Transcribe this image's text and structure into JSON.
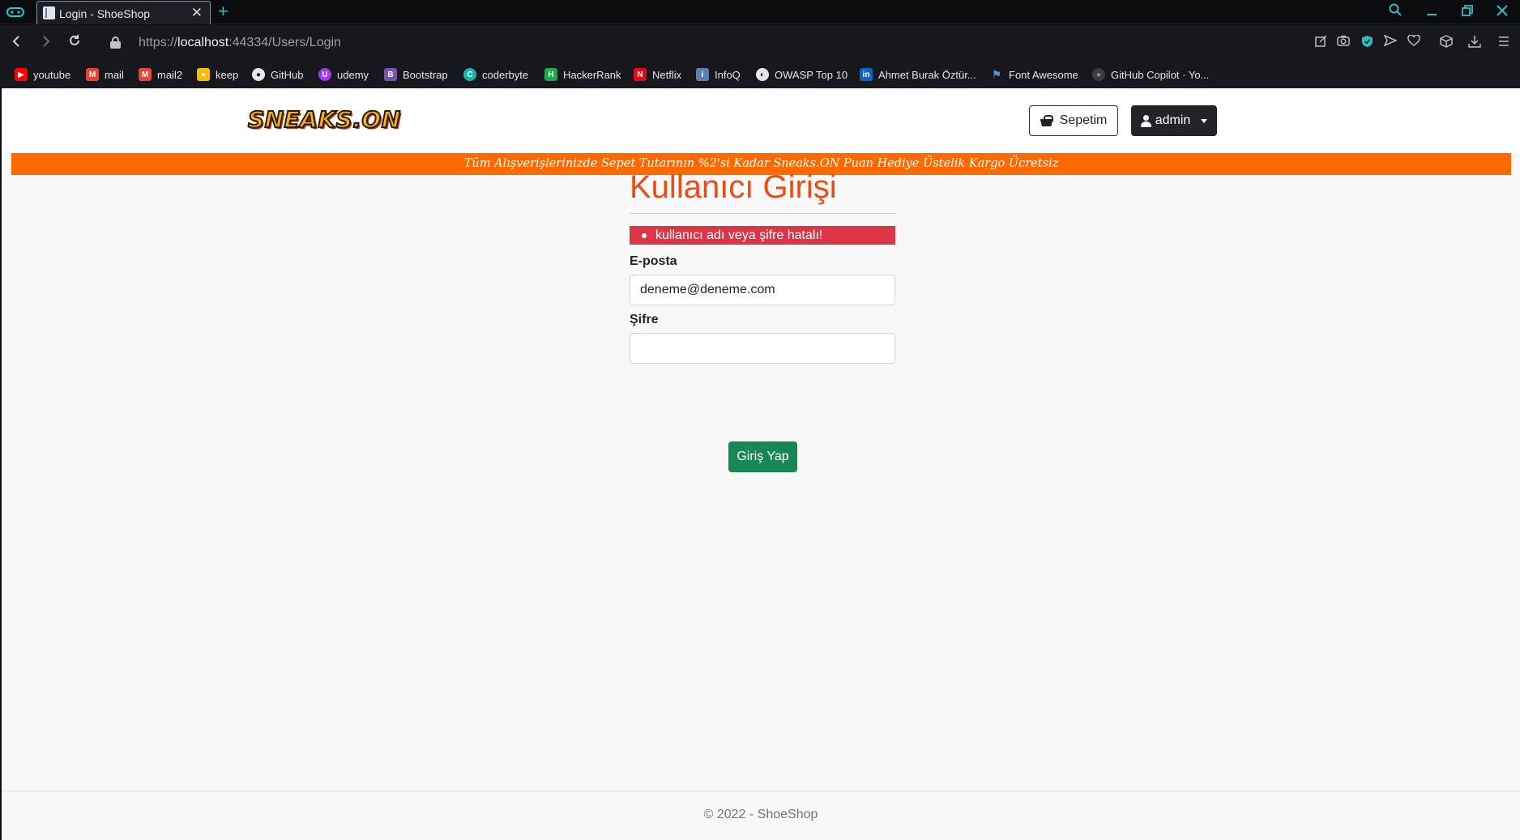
{
  "browser": {
    "tab_title": "Login - ShoeShop",
    "new_tab_glyph": "+",
    "close_glyph": "✕",
    "url_scheme": "https://",
    "url_host": "localhost",
    "url_path": ":44334/Users/Login",
    "bookmarks": [
      {
        "label": "youtube",
        "icon": "youtube-icon",
        "color": "#ff0000",
        "glyph": "▶"
      },
      {
        "label": "mail",
        "icon": "gmail-icon",
        "color": "#ea4335",
        "glyph": "M"
      },
      {
        "label": "mail2",
        "icon": "gmail-icon",
        "color": "#ea4335",
        "glyph": "M"
      },
      {
        "label": "keep",
        "icon": "keep-icon",
        "color": "#fbbc04",
        "glyph": "●"
      },
      {
        "label": "GitHub",
        "icon": "github-icon",
        "color": "#e8e8e8",
        "glyph": "●"
      },
      {
        "label": "udemy",
        "icon": "udemy-icon",
        "color": "#a435f0",
        "glyph": "U"
      },
      {
        "label": "Bootstrap",
        "icon": "bootstrap-icon",
        "color": "#7952b3",
        "glyph": "B"
      },
      {
        "label": "coderbyte",
        "icon": "coderbyte-icon",
        "color": "#14b8a6",
        "glyph": "C"
      },
      {
        "label": "HackerRank",
        "icon": "hackerrank-icon",
        "color": "#1ba94c",
        "glyph": "H"
      },
      {
        "label": "Netflix",
        "icon": "netflix-icon",
        "color": "#e50914",
        "glyph": "N"
      },
      {
        "label": "InfoQ",
        "icon": "infoq-icon",
        "color": "#5b7fb0",
        "glyph": "i"
      },
      {
        "label": "OWASP Top 10",
        "icon": "owasp-icon",
        "color": "#e8e8e8",
        "glyph": "◐"
      },
      {
        "label": "Ahmet Burak Öztür...",
        "icon": "linkedin-icon",
        "color": "#0a66c2",
        "glyph": "in"
      },
      {
        "label": "Font Awesome",
        "icon": "fontawesome-icon",
        "color": "#528dd7",
        "glyph": "⚑"
      },
      {
        "label": "GitHub Copilot · Yo...",
        "icon": "github-copilot-icon",
        "color": "#3a3d42",
        "glyph": "●"
      }
    ]
  },
  "header": {
    "logo_text": "SNEAKS.ON",
    "cart_label": "Sepetim",
    "user_label": "admin"
  },
  "promo": "Tüm Alışverişlerinizde Sepet Tutarının %2'si Kadar Sneaks.ON Puan Hediye Üstelik Kargo Ücretsiz",
  "login": {
    "title": "Kullanıcı Girişi",
    "error": "kullanıcı adı veya şifre hatalı!",
    "email_label": "E-posta",
    "email_value": "deneme@deneme.com",
    "password_label": "Şifre",
    "password_value": "",
    "submit_label": "Giriş Yap"
  },
  "footer": "© 2022 - ShoeShop",
  "colors": {
    "accent_title": "#ef4a10",
    "promo_bg": "#ff6a00",
    "alert_bg": "#dc3545",
    "submit_bg": "#198754",
    "browser_accent": "#2bbfbf"
  }
}
